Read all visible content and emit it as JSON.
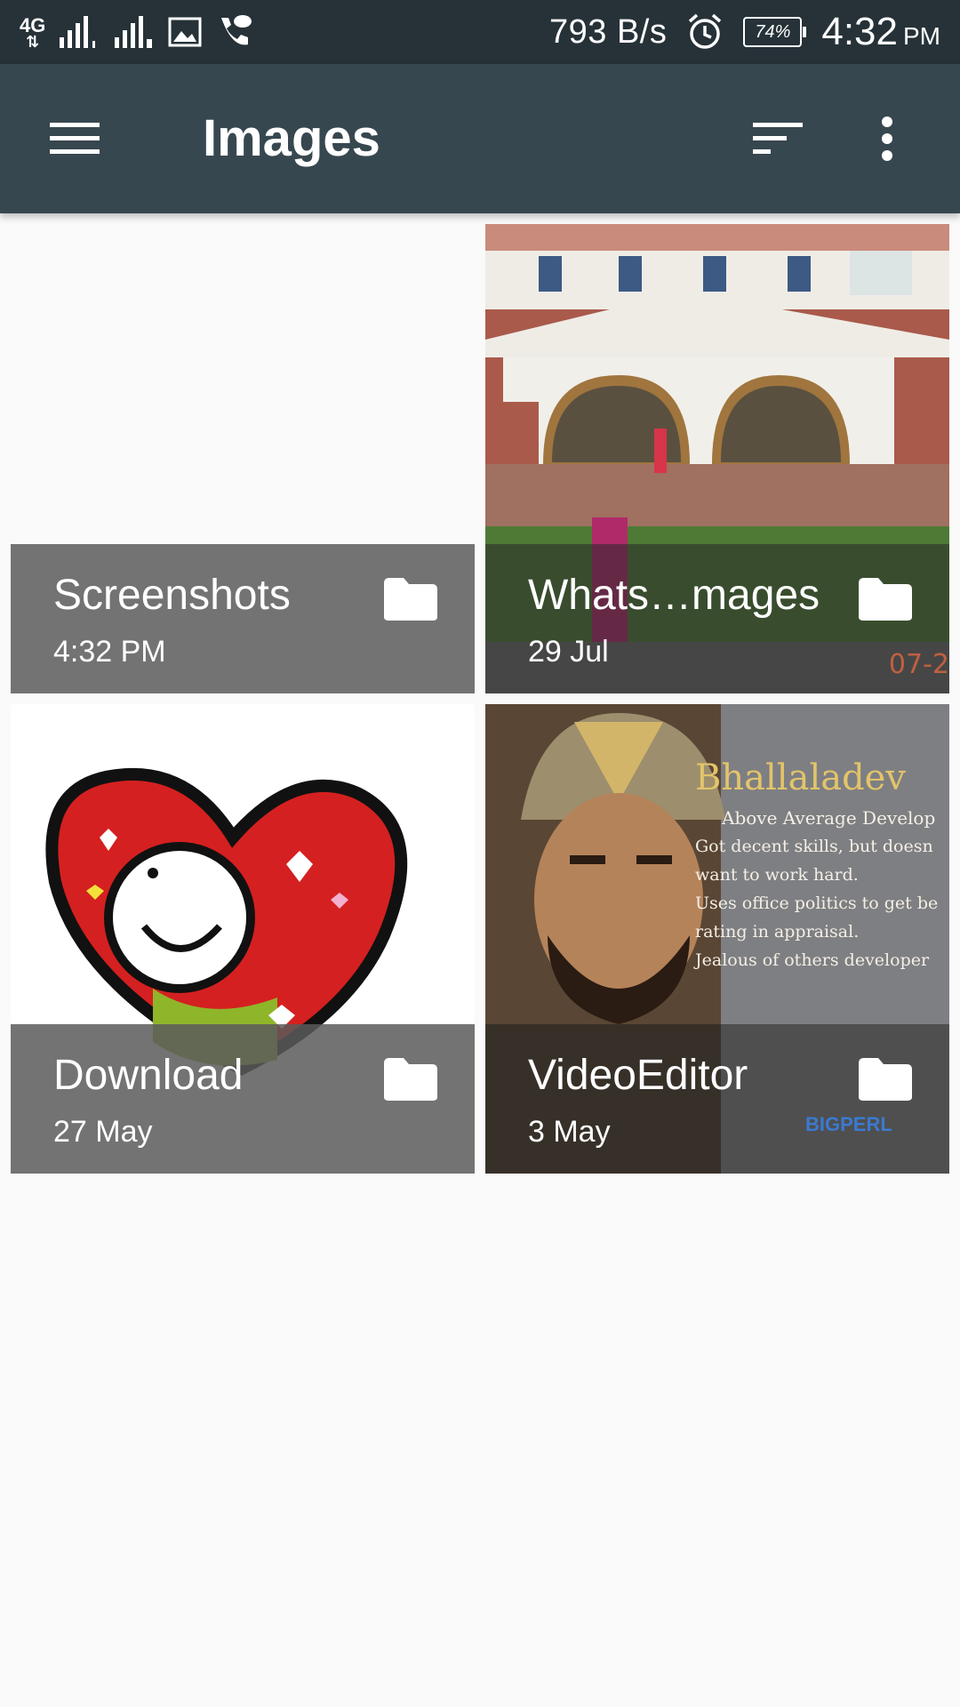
{
  "status_bar": {
    "network": "4G",
    "sim1": "1",
    "sim2": "2",
    "speed": "793 B/s",
    "battery": "74%",
    "time": "4:32",
    "ampm": "PM"
  },
  "app_bar": {
    "title": "Images"
  },
  "folders": [
    {
      "name": "Screenshots",
      "date": "4:32 PM",
      "thumbnail": "blank"
    },
    {
      "name": "Whats…mages",
      "date": "29 Jul",
      "thumbnail": "building-photo"
    },
    {
      "name": "Download",
      "date": "27 May",
      "thumbnail": "heart-sticker"
    },
    {
      "name": "VideoEditor",
      "date": "3 May",
      "thumbnail": "warrior-meme"
    }
  ],
  "thumb_text": {
    "photo_stamp": "07-2",
    "meme_heading": "Bhallaladev",
    "meme_lines": [
      "Above Average Develop",
      "Got decent skills, but doesn",
      "want to work hard.",
      "Uses office politics to get be",
      "rating in appraisal.",
      "Jealous of others developer"
    ],
    "meme_logo": "BIGPERL"
  },
  "colors": {
    "status_bar": "#263238",
    "app_bar": "#37474f",
    "background": "#fafafa",
    "overlay": "#5a5a5a"
  }
}
